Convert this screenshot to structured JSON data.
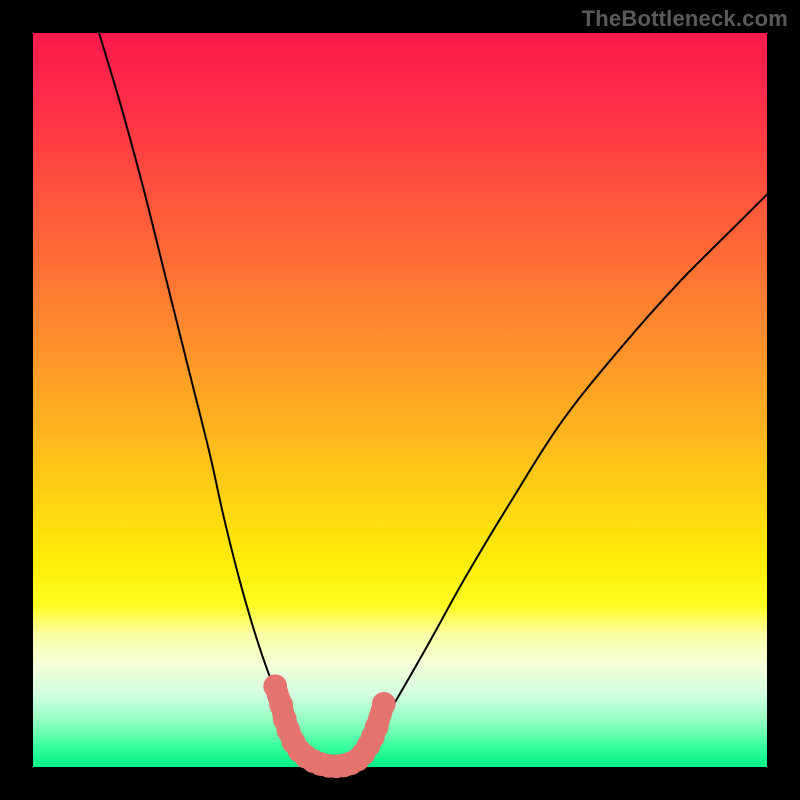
{
  "watermark": "TheBottleneck.com",
  "chart_data": {
    "type": "line",
    "title": "",
    "xlabel": "",
    "ylabel": "",
    "xlim": [
      0,
      100
    ],
    "ylim": [
      0,
      100
    ],
    "grid": false,
    "legend": false,
    "series": [
      {
        "name": "left-curve",
        "x": [
          9,
          12,
          15,
          18,
          21,
          24,
          26,
          28,
          30,
          32,
          34,
          35.5,
          37
        ],
        "values": [
          100,
          90,
          79,
          67,
          55,
          43,
          34,
          26,
          19,
          13,
          8,
          5,
          2
        ]
      },
      {
        "name": "right-curve",
        "x": [
          45,
          47,
          50,
          54,
          59,
          65,
          72,
          80,
          88,
          96,
          100
        ],
        "values": [
          2,
          5,
          10,
          17,
          26,
          36,
          47,
          57,
          66,
          74,
          78
        ]
      },
      {
        "name": "valley-floor",
        "x": [
          37,
          39,
          41,
          43,
          45
        ],
        "values": [
          2,
          0.5,
          0,
          0.5,
          2
        ]
      }
    ],
    "markers": {
      "name": "highlighted-points",
      "color": "#e5746f",
      "points": [
        {
          "x": 33.0,
          "y": 11.0,
          "r": 1.8
        },
        {
          "x": 33.8,
          "y": 8.5,
          "r": 1.8
        },
        {
          "x": 34.3,
          "y": 6.5,
          "r": 1.8
        },
        {
          "x": 34.8,
          "y": 5.0,
          "r": 1.8
        },
        {
          "x": 35.5,
          "y": 3.4,
          "r": 1.8
        },
        {
          "x": 36.3,
          "y": 2.2,
          "r": 1.8
        },
        {
          "x": 37.2,
          "y": 1.4,
          "r": 1.8
        },
        {
          "x": 38.2,
          "y": 0.8,
          "r": 1.8
        },
        {
          "x": 39.2,
          "y": 0.4,
          "r": 1.8
        },
        {
          "x": 40.3,
          "y": 0.15,
          "r": 1.8
        },
        {
          "x": 41.3,
          "y": 0.1,
          "r": 1.8
        },
        {
          "x": 42.3,
          "y": 0.2,
          "r": 1.8
        },
        {
          "x": 43.3,
          "y": 0.5,
          "r": 1.8
        },
        {
          "x": 44.2,
          "y": 1.0,
          "r": 1.8
        },
        {
          "x": 45.0,
          "y": 1.8,
          "r": 1.8
        },
        {
          "x": 45.7,
          "y": 2.9,
          "r": 1.8
        },
        {
          "x": 46.3,
          "y": 4.1,
          "r": 1.8
        },
        {
          "x": 46.8,
          "y": 5.4,
          "r": 1.8
        },
        {
          "x": 47.8,
          "y": 8.6,
          "r": 1.8
        }
      ]
    },
    "background_gradient": {
      "top": "#ff1a4d",
      "mid": "#ffed0a",
      "bottom": "#00ef87"
    }
  }
}
